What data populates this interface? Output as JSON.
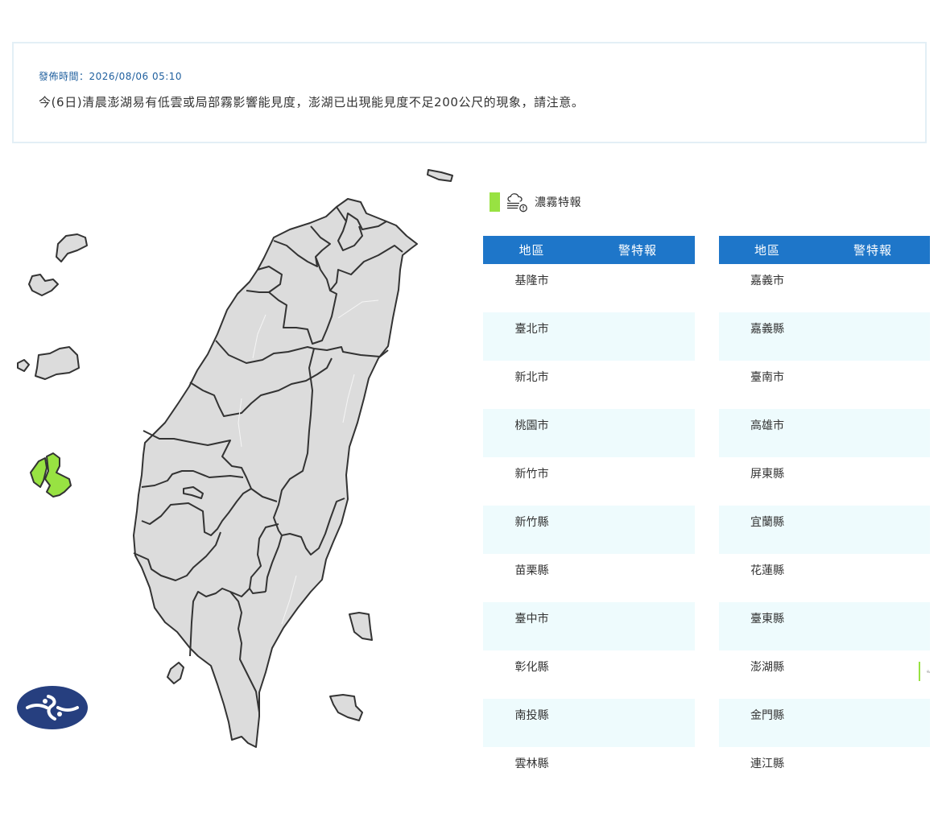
{
  "notice": {
    "time_label": "發佈時間：2026/08/06 05:10",
    "text": "今(6日)清晨澎湖易有低雲或局部霧影響能見度，澎湖已出現能見度不足200公尺的現象，請注意。"
  },
  "legend": {
    "label": "濃霧特報",
    "color": "#98e242",
    "icon": "fog-warning-icon"
  },
  "colors": {
    "header_blue": "#1e76c9",
    "row_alt": "#eefbfd",
    "land": "#dcdcdc",
    "border": "#333333",
    "fog": "#98e242",
    "logo_navy": "#263f7f"
  },
  "tables": [
    {
      "headers": {
        "region": "地區",
        "warning": "警特報"
      },
      "rows": [
        {
          "region": "基隆市",
          "warning": ""
        },
        {
          "region": "臺北市",
          "warning": ""
        },
        {
          "region": "新北市",
          "warning": ""
        },
        {
          "region": "桃園市",
          "warning": ""
        },
        {
          "region": "新竹市",
          "warning": ""
        },
        {
          "region": "新竹縣",
          "warning": ""
        },
        {
          "region": "苗栗縣",
          "warning": ""
        },
        {
          "region": "臺中市",
          "warning": ""
        },
        {
          "region": "彰化縣",
          "warning": ""
        },
        {
          "region": "南投縣",
          "warning": ""
        },
        {
          "region": "雲林縣",
          "warning": ""
        }
      ]
    },
    {
      "headers": {
        "region": "地區",
        "warning": "警特報"
      },
      "rows": [
        {
          "region": "嘉義市",
          "warning": ""
        },
        {
          "region": "嘉義縣",
          "warning": ""
        },
        {
          "region": "臺南市",
          "warning": ""
        },
        {
          "region": "高雄市",
          "warning": ""
        },
        {
          "region": "屏東縣",
          "warning": ""
        },
        {
          "region": "宜蘭縣",
          "warning": ""
        },
        {
          "region": "花蓮縣",
          "warning": ""
        },
        {
          "region": "臺東縣",
          "warning": ""
        },
        {
          "region": "澎湖縣",
          "warning": "fog"
        },
        {
          "region": "金門縣",
          "warning": ""
        },
        {
          "region": "連江縣",
          "warning": ""
        }
      ]
    }
  ]
}
